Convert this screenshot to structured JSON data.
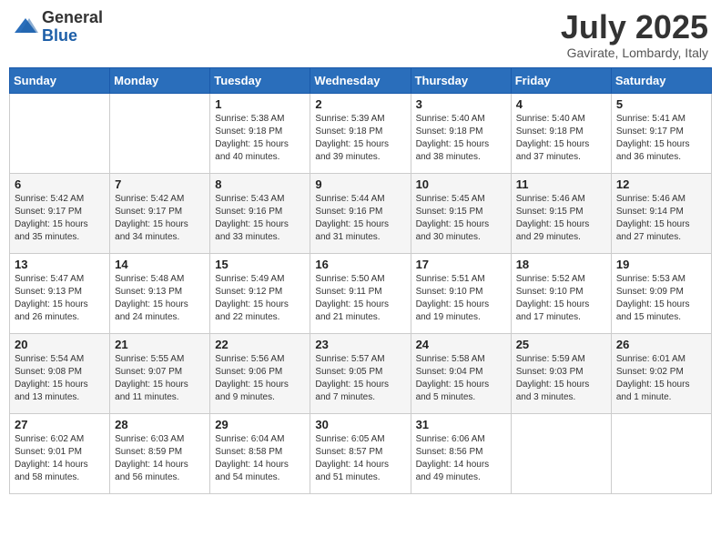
{
  "header": {
    "logo_general": "General",
    "logo_blue": "Blue",
    "month_title": "July 2025",
    "location": "Gavirate, Lombardy, Italy"
  },
  "days_of_week": [
    "Sunday",
    "Monday",
    "Tuesday",
    "Wednesday",
    "Thursday",
    "Friday",
    "Saturday"
  ],
  "weeks": [
    [
      {
        "day": "",
        "info": ""
      },
      {
        "day": "",
        "info": ""
      },
      {
        "day": "1",
        "info": "Sunrise: 5:38 AM\nSunset: 9:18 PM\nDaylight: 15 hours\nand 40 minutes."
      },
      {
        "day": "2",
        "info": "Sunrise: 5:39 AM\nSunset: 9:18 PM\nDaylight: 15 hours\nand 39 minutes."
      },
      {
        "day": "3",
        "info": "Sunrise: 5:40 AM\nSunset: 9:18 PM\nDaylight: 15 hours\nand 38 minutes."
      },
      {
        "day": "4",
        "info": "Sunrise: 5:40 AM\nSunset: 9:18 PM\nDaylight: 15 hours\nand 37 minutes."
      },
      {
        "day": "5",
        "info": "Sunrise: 5:41 AM\nSunset: 9:17 PM\nDaylight: 15 hours\nand 36 minutes."
      }
    ],
    [
      {
        "day": "6",
        "info": "Sunrise: 5:42 AM\nSunset: 9:17 PM\nDaylight: 15 hours\nand 35 minutes."
      },
      {
        "day": "7",
        "info": "Sunrise: 5:42 AM\nSunset: 9:17 PM\nDaylight: 15 hours\nand 34 minutes."
      },
      {
        "day": "8",
        "info": "Sunrise: 5:43 AM\nSunset: 9:16 PM\nDaylight: 15 hours\nand 33 minutes."
      },
      {
        "day": "9",
        "info": "Sunrise: 5:44 AM\nSunset: 9:16 PM\nDaylight: 15 hours\nand 31 minutes."
      },
      {
        "day": "10",
        "info": "Sunrise: 5:45 AM\nSunset: 9:15 PM\nDaylight: 15 hours\nand 30 minutes."
      },
      {
        "day": "11",
        "info": "Sunrise: 5:46 AM\nSunset: 9:15 PM\nDaylight: 15 hours\nand 29 minutes."
      },
      {
        "day": "12",
        "info": "Sunrise: 5:46 AM\nSunset: 9:14 PM\nDaylight: 15 hours\nand 27 minutes."
      }
    ],
    [
      {
        "day": "13",
        "info": "Sunrise: 5:47 AM\nSunset: 9:13 PM\nDaylight: 15 hours\nand 26 minutes."
      },
      {
        "day": "14",
        "info": "Sunrise: 5:48 AM\nSunset: 9:13 PM\nDaylight: 15 hours\nand 24 minutes."
      },
      {
        "day": "15",
        "info": "Sunrise: 5:49 AM\nSunset: 9:12 PM\nDaylight: 15 hours\nand 22 minutes."
      },
      {
        "day": "16",
        "info": "Sunrise: 5:50 AM\nSunset: 9:11 PM\nDaylight: 15 hours\nand 21 minutes."
      },
      {
        "day": "17",
        "info": "Sunrise: 5:51 AM\nSunset: 9:10 PM\nDaylight: 15 hours\nand 19 minutes."
      },
      {
        "day": "18",
        "info": "Sunrise: 5:52 AM\nSunset: 9:10 PM\nDaylight: 15 hours\nand 17 minutes."
      },
      {
        "day": "19",
        "info": "Sunrise: 5:53 AM\nSunset: 9:09 PM\nDaylight: 15 hours\nand 15 minutes."
      }
    ],
    [
      {
        "day": "20",
        "info": "Sunrise: 5:54 AM\nSunset: 9:08 PM\nDaylight: 15 hours\nand 13 minutes."
      },
      {
        "day": "21",
        "info": "Sunrise: 5:55 AM\nSunset: 9:07 PM\nDaylight: 15 hours\nand 11 minutes."
      },
      {
        "day": "22",
        "info": "Sunrise: 5:56 AM\nSunset: 9:06 PM\nDaylight: 15 hours\nand 9 minutes."
      },
      {
        "day": "23",
        "info": "Sunrise: 5:57 AM\nSunset: 9:05 PM\nDaylight: 15 hours\nand 7 minutes."
      },
      {
        "day": "24",
        "info": "Sunrise: 5:58 AM\nSunset: 9:04 PM\nDaylight: 15 hours\nand 5 minutes."
      },
      {
        "day": "25",
        "info": "Sunrise: 5:59 AM\nSunset: 9:03 PM\nDaylight: 15 hours\nand 3 minutes."
      },
      {
        "day": "26",
        "info": "Sunrise: 6:01 AM\nSunset: 9:02 PM\nDaylight: 15 hours\nand 1 minute."
      }
    ],
    [
      {
        "day": "27",
        "info": "Sunrise: 6:02 AM\nSunset: 9:01 PM\nDaylight: 14 hours\nand 58 minutes."
      },
      {
        "day": "28",
        "info": "Sunrise: 6:03 AM\nSunset: 8:59 PM\nDaylight: 14 hours\nand 56 minutes."
      },
      {
        "day": "29",
        "info": "Sunrise: 6:04 AM\nSunset: 8:58 PM\nDaylight: 14 hours\nand 54 minutes."
      },
      {
        "day": "30",
        "info": "Sunrise: 6:05 AM\nSunset: 8:57 PM\nDaylight: 14 hours\nand 51 minutes."
      },
      {
        "day": "31",
        "info": "Sunrise: 6:06 AM\nSunset: 8:56 PM\nDaylight: 14 hours\nand 49 minutes."
      },
      {
        "day": "",
        "info": ""
      },
      {
        "day": "",
        "info": ""
      }
    ]
  ]
}
